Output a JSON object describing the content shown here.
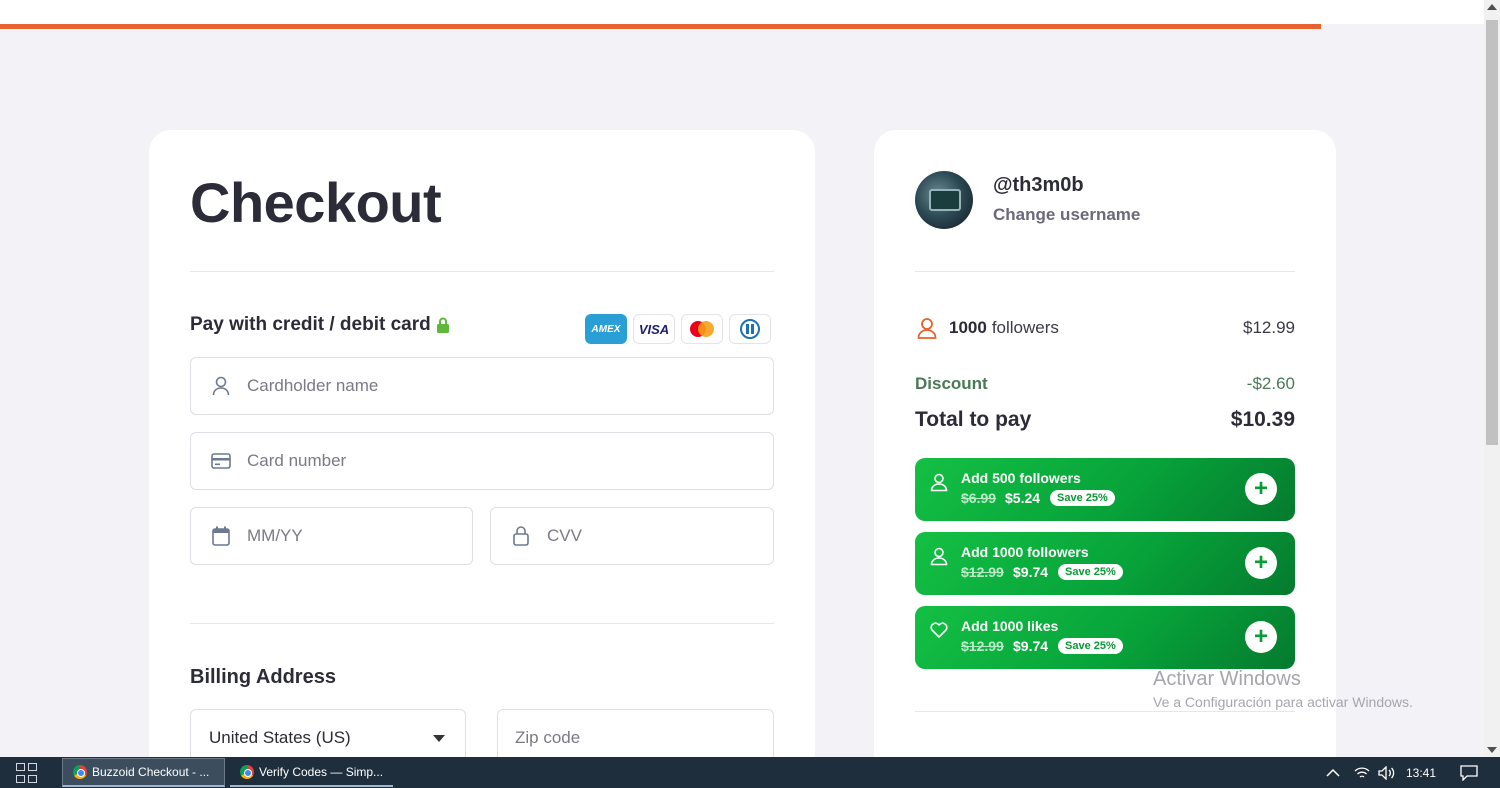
{
  "progress": {
    "percent": 89
  },
  "checkout": {
    "title": "Checkout",
    "pay_label": "Pay with credit / debit card",
    "card_logos": [
      "AMEX",
      "VISA",
      "mastercard-icon",
      "diners-icon"
    ],
    "fields": {
      "cardholder_placeholder": "Cardholder name",
      "card_number_placeholder": "Card number",
      "expiry_placeholder": "MM/YY",
      "cvv_placeholder": "CVV"
    },
    "billing": {
      "title": "Billing Address",
      "country": "United States (US)",
      "zip_placeholder": "Zip code"
    }
  },
  "summary": {
    "username": "@th3m0b",
    "change_username": "Change username",
    "item": {
      "qty": "1000",
      "unit": "followers",
      "price": "$12.99"
    },
    "discount_label": "Discount",
    "discount_value": "-$2.60",
    "total_label": "Total to pay",
    "total_value": "$10.39",
    "upsells": [
      {
        "prefix": "Add ",
        "bold": "500 followers",
        "old": "$6.99",
        "new": "$5.24",
        "save": "Save 25%",
        "icon": "user-icon"
      },
      {
        "prefix": "Add ",
        "bold": "1000 followers",
        "old": "$12.99",
        "new": "$9.74",
        "save": "Save 25%",
        "icon": "user-icon"
      },
      {
        "prefix": "Add ",
        "bold": "1000 likes",
        "old": "$12.99",
        "new": "$9.74",
        "save": "Save 25%",
        "icon": "heart-icon"
      }
    ]
  },
  "watermark": {
    "line1": "Activar Windows",
    "line2": "Ve a Configuración para activar Windows."
  },
  "taskbar": {
    "tasks": [
      "Buzzoid Checkout - ...",
      "Verify Codes — Simp..."
    ],
    "time": "13:41"
  },
  "colors": {
    "accent": "#e7622e",
    "green": "#07a33a"
  }
}
